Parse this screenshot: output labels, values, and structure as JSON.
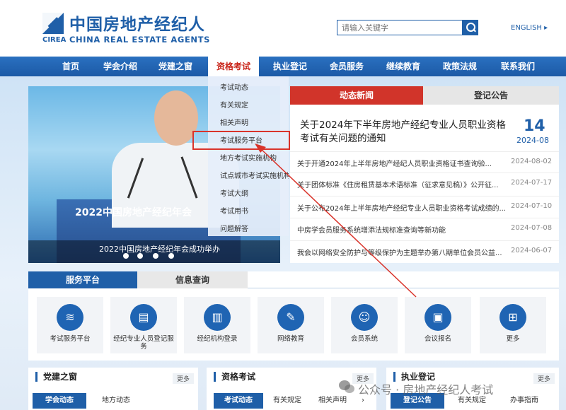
{
  "header": {
    "logo_cn": "中国房地产经纪人",
    "logo_abbr": "CIREA",
    "logo_en": "CHINA REAL ESTATE AGENTS",
    "search_placeholder": "请输入关键字",
    "lang": "ENGLISH ▸"
  },
  "nav": {
    "items": [
      "首页",
      "学会介绍",
      "党建之窗",
      "资格考试",
      "执业登记",
      "会员服务",
      "继续教育",
      "政策法规",
      "联系我们"
    ],
    "active": "资格考试"
  },
  "dropdown": {
    "items": [
      "考试动态",
      "有关规定",
      "相关声明",
      "考试服务平台",
      "地方考试实施机构",
      "试点城市考试实施机构",
      "考试大纲",
      "考试用书",
      "问题解答"
    ]
  },
  "banner": {
    "stage_text": "2022中国房地产经纪年会",
    "caption": "2022中国房地产经纪年会成功举办"
  },
  "news": {
    "tabs": [
      "动态新闻",
      "登记公告"
    ],
    "headline": "关于2024年下半年房地产经纪专业人员职业资格考试有关问题的通知",
    "headline_day": "14",
    "headline_ym": "2024-08",
    "rows": [
      {
        "title": "关于开通2024年上半年房地产经纪人员职业资格证书查询验...",
        "date": "2024-08-02"
      },
      {
        "title": "关于团体标准《住房租赁基本术语标准（征求意见稿）》公开征...",
        "date": "2024-07-17"
      },
      {
        "title": "关于公布2024年上半年房地产经纪专业人员职业资格考试成绩的...",
        "date": "2024-07-10"
      },
      {
        "title": "中房学会员服务系统增添法规标准查询等新功能",
        "date": "2024-07-08"
      },
      {
        "title": "我会以网络安全防护与等级保护为主题举办第八期单位会员公益...",
        "date": "2024-06-07"
      }
    ]
  },
  "services": {
    "tabs": [
      "服务平台",
      "信息查询"
    ],
    "items": [
      {
        "label": "考试服务平台",
        "icon": "layers-icon",
        "glyph": "≋"
      },
      {
        "label": "经纪专业人员登记服务",
        "icon": "document-icon",
        "glyph": "▤"
      },
      {
        "label": "经纪机构登录",
        "icon": "building-icon",
        "glyph": "▥"
      },
      {
        "label": "网络教育",
        "icon": "education-icon",
        "glyph": "✎"
      },
      {
        "label": "会员系统",
        "icon": "users-icon",
        "glyph": "☺"
      },
      {
        "label": "会议报名",
        "icon": "meeting-icon",
        "glyph": "▣"
      },
      {
        "label": "更多",
        "icon": "grid-icon",
        "glyph": "⊞"
      }
    ]
  },
  "panels": [
    {
      "title": "党建之窗",
      "more": "更多",
      "tabs": [
        "学会动态",
        "地方动态"
      ]
    },
    {
      "title": "资格考试",
      "more": "更多",
      "tabs": [
        "考试动态",
        "有关规定",
        "相关声明",
        "›"
      ]
    },
    {
      "title": "执业登记",
      "more": "更多",
      "tabs": [
        "登记公告",
        "有关规定",
        "办事指南"
      ]
    }
  ],
  "watermark": "公众号 · 房地产经纪人考试",
  "colors": {
    "brand": "#1f5fa8",
    "accent_red": "#d1342a"
  }
}
